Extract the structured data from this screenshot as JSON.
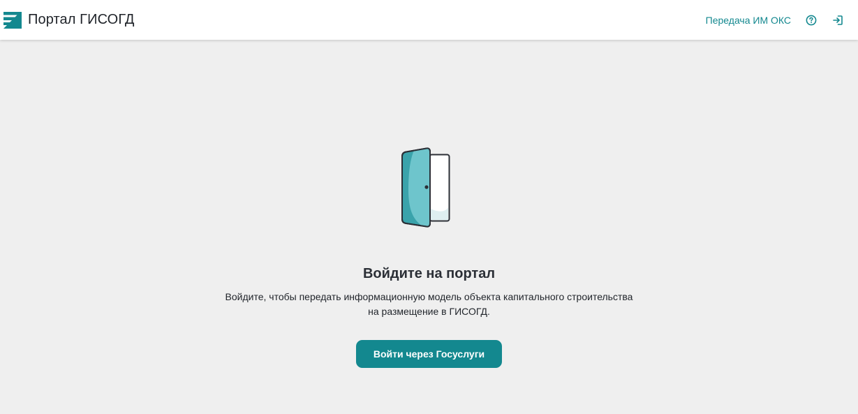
{
  "header": {
    "title": "Портал ГИСОГД",
    "nav_link": "Передача ИМ ОКС",
    "icons": [
      "help-icon",
      "login-icon"
    ]
  },
  "main": {
    "heading": "Войдите на портал",
    "description_line1": "Войдите, чтобы передать информационную модель объекта капитального строительства",
    "description_line2": "на размещение в ГИСОГД.",
    "login_button": "Войти через Госуслуги"
  },
  "colors": {
    "accent": "#13888f",
    "background": "#efefef",
    "header": "#ffffff",
    "door_light": "#6ec5cc",
    "door_dark": "#3aa3ab"
  }
}
